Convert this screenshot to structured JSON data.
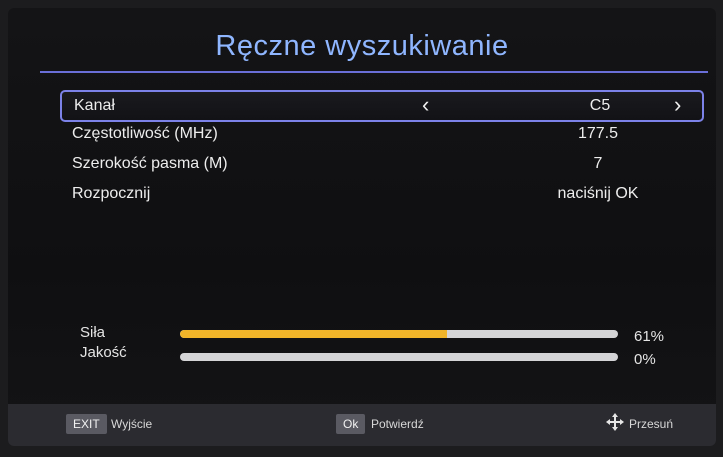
{
  "header": {
    "title": "Ręczne wyszukiwanie"
  },
  "settings": [
    {
      "label": "Kanał",
      "value": "C5"
    },
    {
      "label": "Częstotliwość (MHz)",
      "value": "177.5"
    },
    {
      "label": "Szerokość pasma (M)",
      "value": "7"
    },
    {
      "label": "Rozpocznij",
      "value": "naciśnij OK"
    }
  ],
  "meters": {
    "strength": {
      "label": "Siła",
      "value_text": "61%",
      "level": 0.61
    },
    "quality": {
      "label": "Jakość",
      "value_text": "0%",
      "level": 0
    }
  },
  "footer": {
    "exit_key": "EXIT",
    "exit_label": "Wyjście",
    "ok_key": "Ok",
    "ok_label": "Potwierdź",
    "move_icon": "move-arrows-icon",
    "move_label": "Przesuń"
  },
  "colors": {
    "accent": "#7c82e8",
    "title": "#8fb6ff",
    "strength_bar": "#f0b429"
  }
}
